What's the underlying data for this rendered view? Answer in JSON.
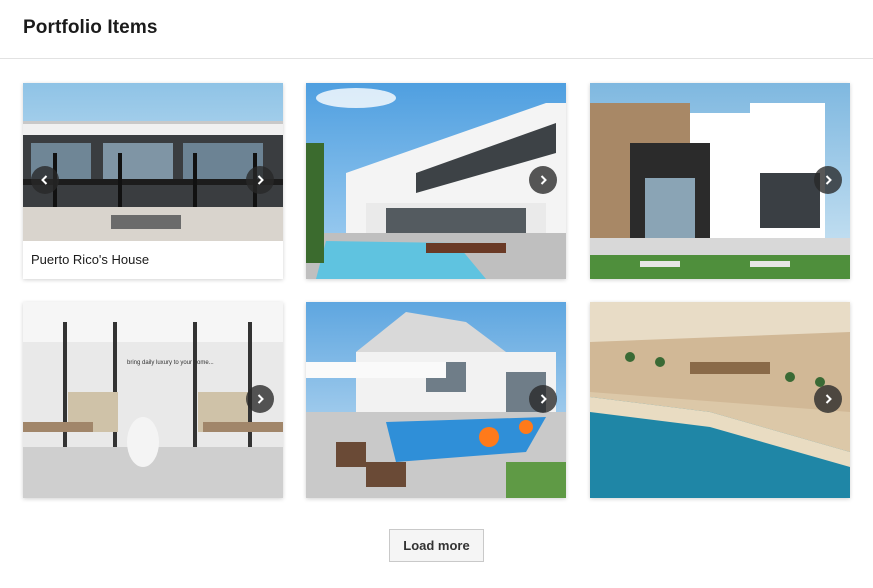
{
  "header": {
    "title": "Portfolio Items"
  },
  "items": [
    {
      "caption": "Puerto Rico's House",
      "nav": [
        "previous",
        "next"
      ]
    },
    {
      "caption": "",
      "nav": [
        "next"
      ]
    },
    {
      "caption": "",
      "nav": [
        "next"
      ]
    },
    {
      "caption": "",
      "nav": [
        "next"
      ],
      "wall_text": "bring daily luxury to your home..."
    },
    {
      "caption": "",
      "nav": [
        "next"
      ]
    },
    {
      "caption": "",
      "nav": [
        "next"
      ]
    }
  ],
  "load_more": {
    "label": "Load more"
  },
  "icons": {
    "previous": "chevron-left-icon",
    "next": "chevron-right-icon"
  },
  "colors": {
    "nav_button": "#2d2d2d",
    "border": "#e2e2e2",
    "button_bg": "#f5f5f5"
  }
}
